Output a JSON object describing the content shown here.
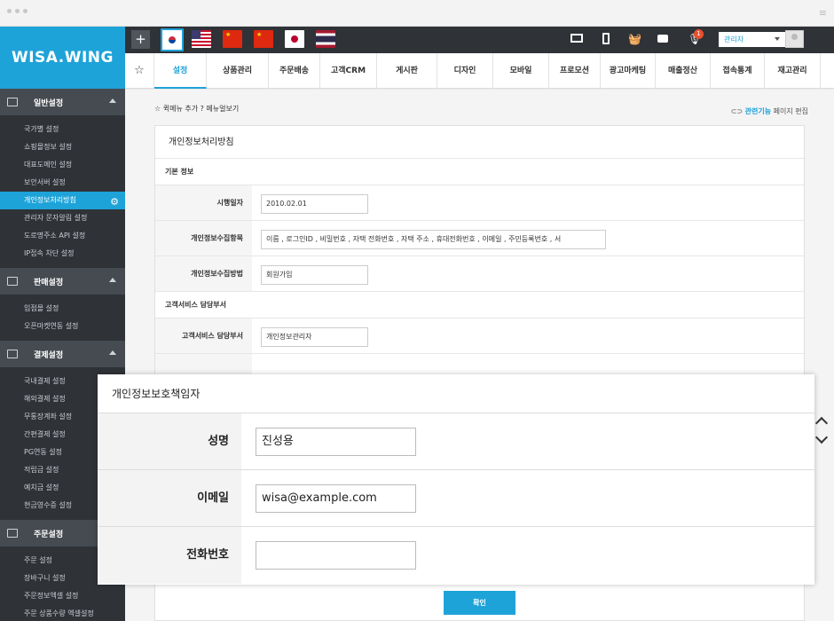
{
  "brand": {
    "logo": "WISA.WING",
    "accent": "#1ea3d9",
    "sidebar_bg": "#2f3237"
  },
  "sidebar": {
    "sections": [
      {
        "title": "일반설정",
        "icon": "window-icon",
        "items": [
          "국가별 설정",
          "쇼핑몰정보 설정",
          "대표도메인 설정",
          "보안서버 설정",
          "개인정보처리방침",
          "관리자 문자알림 설정",
          "도로명주소 API 설정",
          "IP접속 차단 설정"
        ],
        "active_index": 4
      },
      {
        "title": "판매설정",
        "icon": "mail-icon",
        "items": [
          "입점몰 설정",
          "오픈마켓연동 설정"
        ]
      },
      {
        "title": "결제설정",
        "icon": "wallet-icon",
        "items": [
          "국내결제 설정",
          "해외결제 설정",
          "무통장계좌 설정",
          "간편결제 설정",
          "PG연동 설정",
          "적립금 설정",
          "예치금 설정",
          "현금영수증 설정"
        ]
      },
      {
        "title": "주문설정",
        "icon": "document-icon",
        "items": [
          "주문 설정",
          "장바구니 설정",
          "주문정보엑셀 설정",
          "주문 상품수량 엑셀설정"
        ]
      }
    ]
  },
  "topbar": {
    "plus": "+",
    "languages": [
      "korea-flag-icon",
      "usa-flag-icon",
      "china-flag-icon",
      "china-flag-icon",
      "japan-flag-icon",
      "thailand-flag-icon"
    ],
    "notification_count": "1",
    "user_role": "관리자"
  },
  "nav": {
    "tabs": [
      "설정",
      "상품관리",
      "주문배송",
      "고객CRM",
      "게시판",
      "디자인",
      "모바일",
      "프로모션",
      "광고마케팅",
      "매출정산",
      "접속통계",
      "재고관리"
    ],
    "active_index": 0
  },
  "crumb": {
    "add_quick_menu": "퀵메뉴 추가",
    "help": "?",
    "view_manual": "메뉴얼보기"
  },
  "related": {
    "label": "관련기능",
    "action": "페이지 편집"
  },
  "page": {
    "title": "개인정보처리방침",
    "basic_section": "기본 정보",
    "rows": [
      {
        "label": "시행일자",
        "value": "2010.02.01"
      },
      {
        "label": "개인정보수집항목",
        "value": "이름 , 로그인ID , 비밀번호 , 자택 전화번호 , 자택 주소 , 휴대전화번호 , 이메일 , 주민등록번호 , 서"
      },
      {
        "label": "개인정보수집방법",
        "value": "회원가입"
      }
    ],
    "cs_section": "고객서비스 담당부서",
    "cs_row": {
      "label": "고객서비스 담당부서",
      "value": "개인정보관리자"
    },
    "confirm": "확인"
  },
  "modal": {
    "title": "개인정보보호책임자",
    "rows": [
      {
        "label": "성명",
        "value": "진성용"
      },
      {
        "label": "이메일",
        "value": "wisa@example.com"
      },
      {
        "label": "전화번호",
        "value": ""
      }
    ]
  }
}
